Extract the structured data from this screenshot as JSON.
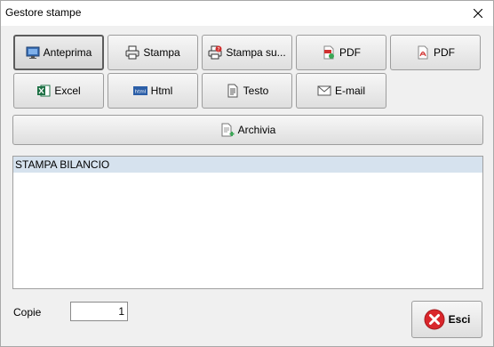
{
  "window": {
    "title": "Gestore stampe"
  },
  "toolbar_row1": [
    {
      "label": "Anteprima",
      "icon": "monitor-icon"
    },
    {
      "label": "Stampa",
      "icon": "printer-icon"
    },
    {
      "label": "Stampa su...",
      "icon": "printer-question-icon"
    },
    {
      "label": "PDF",
      "icon": "pdf-file-icon"
    },
    {
      "label": "PDF",
      "icon": "pdf-acrobat-icon"
    }
  ],
  "toolbar_row2": [
    {
      "label": "Excel",
      "icon": "excel-icon"
    },
    {
      "label": "Html",
      "icon": "html-icon"
    },
    {
      "label": "Testo",
      "icon": "text-document-icon"
    },
    {
      "label": "E-mail",
      "icon": "envelope-icon"
    }
  ],
  "archivia": {
    "label": "Archivia",
    "icon": "archive-document-icon"
  },
  "report_list": {
    "items": [
      "STAMPA BILANCIO"
    ]
  },
  "copie": {
    "label": "Copie",
    "value": "1"
  },
  "esci": {
    "label": "Esci",
    "icon": "exit-x-icon"
  },
  "colors": {
    "selected_row": "#d6e2ee",
    "window_bg": "#f0f0f0",
    "esci_red": "#d9262b"
  }
}
